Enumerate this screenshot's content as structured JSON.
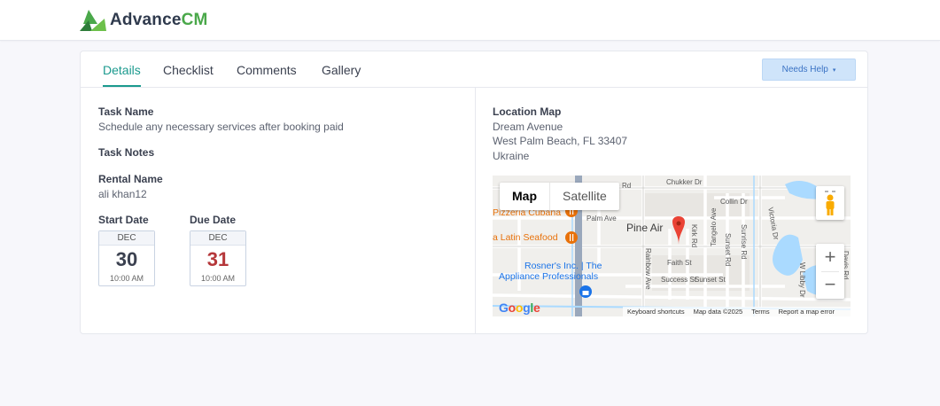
{
  "brand": {
    "name_a": "Advance",
    "name_b": "CM"
  },
  "tabs": [
    {
      "label": "Details",
      "active": true
    },
    {
      "label": "Checklist",
      "active": false
    },
    {
      "label": "Comments",
      "active": false
    },
    {
      "label": "Gallery",
      "active": false
    }
  ],
  "help_button": {
    "label": "Needs Help",
    "caret": "▾"
  },
  "details": {
    "task_name_label": "Task Name",
    "task_name": "Schedule any necessary services after booking paid",
    "task_notes_label": "Task Notes",
    "rental_name_label": "Rental Name",
    "rental_name": "ali khan12",
    "start_date_label": "Start Date",
    "start_date": {
      "month": "DEC",
      "day": "30",
      "time": "10:00 AM"
    },
    "due_date_label": "Due Date",
    "due_date": {
      "month": "DEC",
      "day": "31",
      "time": "10:00 AM"
    }
  },
  "location": {
    "label": "Location Map",
    "line1": "Dream Avenue",
    "line2": "West Palm Beach, FL 33407",
    "line3": "Ukraine"
  },
  "map": {
    "type_map": "Map",
    "type_satellite": "Satellite",
    "zoom_in": "+",
    "zoom_out": "−",
    "streets": {
      "rd": "Rd",
      "chukker": "Chukker Dr",
      "collin": "Collin Dr",
      "palm": "Palm Ave",
      "kirk": "Kirk Rd",
      "sunset_rd": "Sunset Rd",
      "sunrise": "Sunrise Rd",
      "victoria": "Victoria Dr",
      "tangelo": "Tangelo Ave",
      "rainbow": "Rainbow Ave",
      "faith": "Faith St",
      "success": "Success St",
      "sunset_st": "Sunset St",
      "libby": "W Libby Dr",
      "davis": "Davis Rd"
    },
    "place": "Pine Air",
    "pois": {
      "pizzeria": "Pizzeria Cubana",
      "seafood": "a Latin Seafood",
      "rosner1": "Rosner's Inc. | The",
      "rosner2": "Appliance Professionals"
    },
    "footer": {
      "shortcuts": "Keyboard shortcuts",
      "data": "Map data ©2025",
      "terms": "Terms",
      "report": "Report a map error"
    },
    "google": "Google",
    "colors": {
      "road": "#ffffff",
      "highway": "#9aa8bc",
      "water": "#aadaff",
      "pin": "#ea4335",
      "poi_orange": "#e8710a",
      "poi_blue": "#1a73e8"
    }
  }
}
